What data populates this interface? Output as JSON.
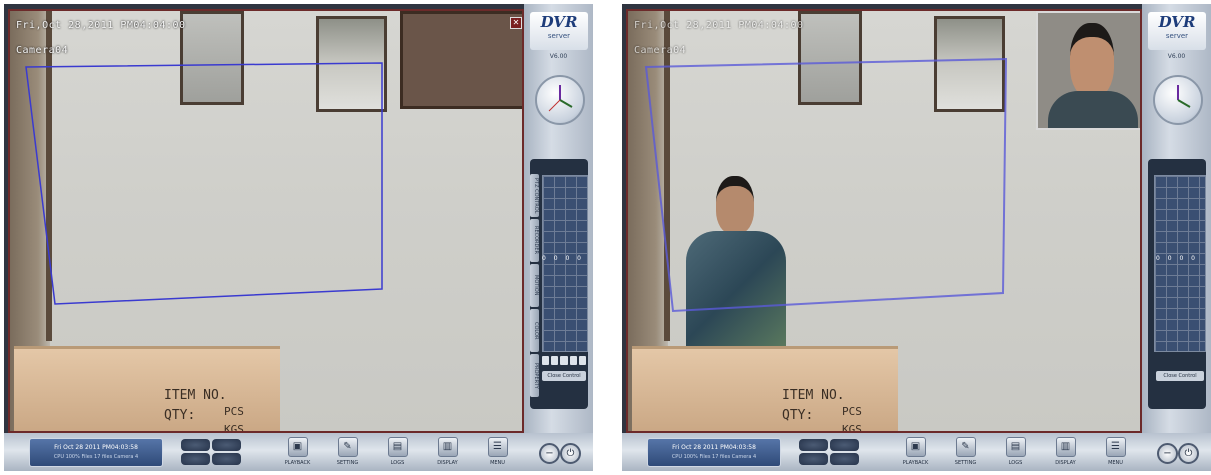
{
  "left_screen": {
    "osd_datetime": "Fri,Oct 28,2011 PM04:04:00",
    "osd_camera": "Camera04",
    "box_item": "ITEM NO.",
    "box_qty": "QTY:",
    "box_hw": "PCS",
    "box_kgs": "KGS",
    "footer_date": "Fri Oct 28 2011  PM04:03:58",
    "footer_info": "CPU 100%   Files 17 files   Camera 4"
  },
  "right_screen": {
    "osd_datetime": "Fri,Oct 28,2011 PM04:04:00",
    "osd_camera": "Camera04",
    "box_item": "ITEM NO.",
    "box_qty": "QTY:",
    "box_hw": "PCS",
    "box_kgs": "KGS",
    "footer_date": "Fri Oct 28 2011  PM04:03:58",
    "footer_info": "CPU 100%   Files 17 files   Camera 4"
  },
  "sidebar": {
    "logo": "DVR",
    "logo_sub": "server",
    "version": "V6.00",
    "tabs": [
      "PTZ CONTROL",
      "RECORDER",
      "MOTION",
      "COLOR",
      "PROPERTY"
    ],
    "panel_button": "Close Control",
    "dots": "0 0 0 0"
  },
  "toolbar": {
    "playback": "PLAYBACK",
    "setting": "SETTING",
    "logs": "LOGS",
    "display": "DISPLAY",
    "menu": "MENU"
  },
  "colors": {
    "roi": "#3a3ad0",
    "frame_border": "#6c2a2a",
    "accent_blue": "#2f4a78"
  },
  "icons": {
    "minimize": "minus-icon",
    "power": "power-icon",
    "close": "close-icon"
  }
}
